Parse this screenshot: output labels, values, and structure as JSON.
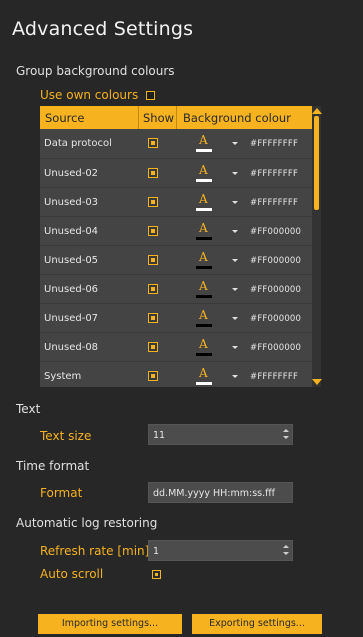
{
  "title": "Advanced Settings",
  "group_bg": {
    "heading": "Group background colours",
    "use_own_label": "Use own colours",
    "use_own_checked": false
  },
  "table": {
    "headers": [
      "Source",
      "Show",
      "Background colour"
    ],
    "rows": [
      {
        "source": "Data protocol",
        "show": true,
        "color": "#FFFFFFFF",
        "swatch": "#ffffff"
      },
      {
        "source": "Unused-02",
        "show": true,
        "color": "#FFFFFFFF",
        "swatch": "#ffffff"
      },
      {
        "source": "Unused-03",
        "show": true,
        "color": "#FFFFFFFF",
        "swatch": "#ffffff"
      },
      {
        "source": "Unused-04",
        "show": true,
        "color": "#FF000000",
        "swatch": "#000000"
      },
      {
        "source": "Unused-05",
        "show": true,
        "color": "#FF000000",
        "swatch": "#000000"
      },
      {
        "source": "Unused-06",
        "show": true,
        "color": "#FF000000",
        "swatch": "#000000"
      },
      {
        "source": "Unused-07",
        "show": true,
        "color": "#FF000000",
        "swatch": "#000000"
      },
      {
        "source": "Unused-08",
        "show": true,
        "color": "#FF000000",
        "swatch": "#000000"
      },
      {
        "source": "System",
        "show": true,
        "color": "#FFFFFFFF",
        "swatch": "#ffffff"
      }
    ]
  },
  "text_section": {
    "heading": "Text",
    "size_label": "Text size",
    "size_value": "11"
  },
  "time_section": {
    "heading": "Time format",
    "format_label": "Format",
    "format_value": "dd.MM.yyyy HH:mm:ss.fff"
  },
  "log_section": {
    "heading": "Automatic log restoring",
    "refresh_label": "Refresh rate [min]",
    "refresh_value": "1",
    "autoscroll_label": "Auto scroll",
    "autoscroll_checked": true
  },
  "buttons": {
    "import": "Importing settings...",
    "export": "Exporting settings..."
  },
  "colors": {
    "accent": "#f6b21f",
    "background": "#272727"
  }
}
